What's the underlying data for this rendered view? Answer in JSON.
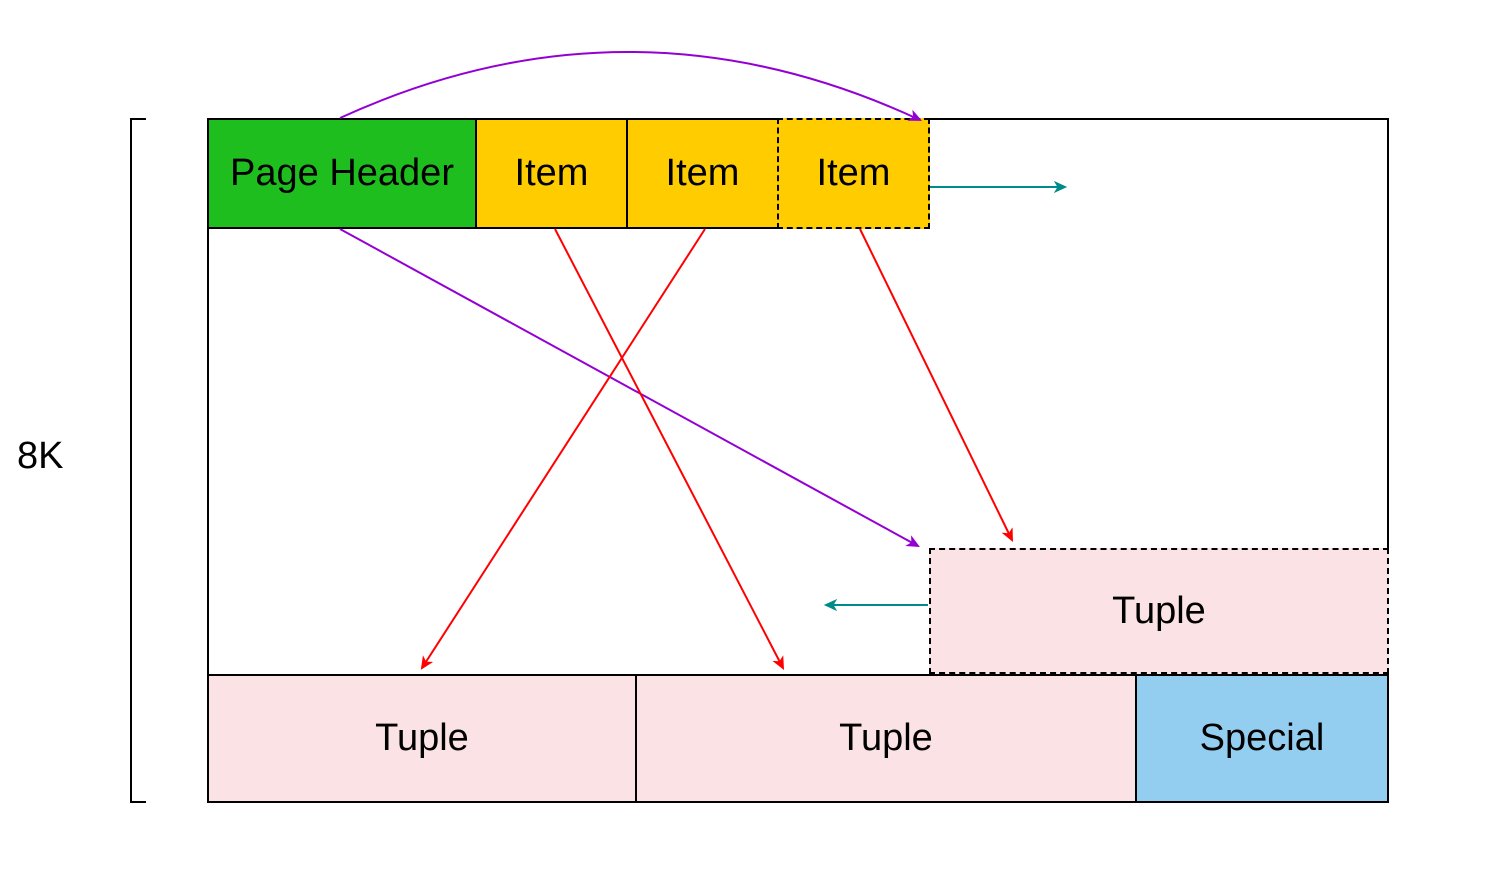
{
  "size_label": "8K",
  "colors": {
    "header": "#1FBE1F",
    "item": "#FFCC00",
    "tuple": "#FBE2E4",
    "special": "#93CDEF",
    "arrow_purple": "#9400D3",
    "arrow_red": "#FF0000",
    "arrow_teal": "#008B8B"
  },
  "blocks": {
    "page_header": "Page Header",
    "item1": "Item",
    "item2": "Item",
    "item3": "Item",
    "tuple_top": "Tuple",
    "tuple_b1": "Tuple",
    "tuple_b2": "Tuple",
    "special": "Special"
  }
}
